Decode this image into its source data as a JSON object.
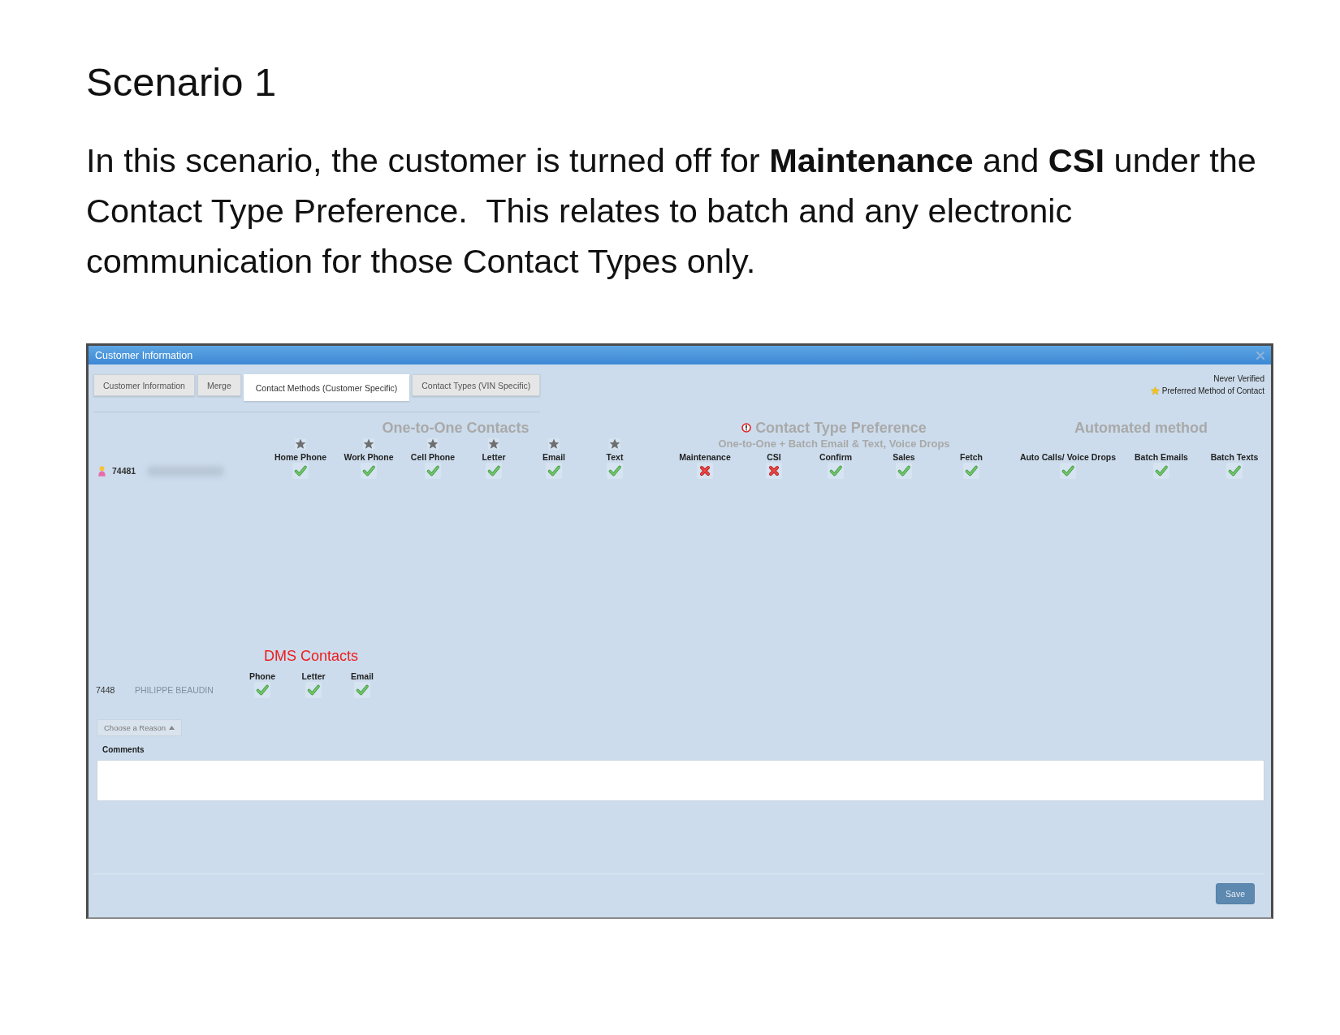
{
  "document": {
    "title": "Scenario 1",
    "paragraph": "In this scenario, the customer is turned off for **Maintenance** and **CSI** under the Contact Type Preference.  This relates to batch and any electronic communication for those Contact Types only."
  },
  "window": {
    "title": "Customer Information"
  },
  "tabs": [
    {
      "label": "Customer Information",
      "selected": false
    },
    {
      "label": "Merge",
      "selected": false
    },
    {
      "label": "Contact Methods (Customer Specific)",
      "selected": true
    },
    {
      "label": "Contact Types (VIN Specific)",
      "selected": false
    }
  ],
  "legend": {
    "status": "Never Verified",
    "preferred_label": "Preferred Method of Contact"
  },
  "customer": {
    "id": "74481",
    "name_hidden": true
  },
  "groups": [
    {
      "kind": "one_to_one",
      "title": "One-to-One Contacts",
      "columns": [
        {
          "label": "Home Phone",
          "preferred": false,
          "enabled": true
        },
        {
          "label": "Work Phone",
          "preferred": false,
          "enabled": true
        },
        {
          "label": "Cell Phone",
          "preferred": false,
          "enabled": true
        },
        {
          "label": "Letter",
          "preferred": false,
          "enabled": true
        },
        {
          "label": "Email",
          "preferred": false,
          "enabled": true
        },
        {
          "label": "Text",
          "preferred": false,
          "enabled": true
        }
      ]
    },
    {
      "kind": "contact_type",
      "title": "Contact Type Preference",
      "warning": true,
      "subtitle": "One-to-One + Batch Email & Text, Voice Drops",
      "columns": [
        {
          "label": "Maintenance",
          "enabled": false
        },
        {
          "label": "CSI",
          "enabled": false
        },
        {
          "label": "Confirm",
          "enabled": true
        },
        {
          "label": "Sales",
          "enabled": true
        },
        {
          "label": "Fetch",
          "enabled": true
        }
      ]
    },
    {
      "kind": "automated",
      "title": "Automated method",
      "columns": [
        {
          "label": "Auto Calls/ Voice Drops",
          "enabled": true
        },
        {
          "label": "Batch Emails",
          "enabled": true
        },
        {
          "label": "Batch Texts",
          "enabled": true
        }
      ]
    }
  ],
  "dms": {
    "title": "DMS Contacts",
    "id": "7448",
    "name": "PHILIPPE BEAUDIN",
    "columns": [
      {
        "label": "Phone",
        "enabled": true
      },
      {
        "label": "Letter",
        "enabled": true
      },
      {
        "label": "Email",
        "enabled": true
      }
    ]
  },
  "reason_button": {
    "label": "Choose a Reason"
  },
  "comments": {
    "label": "Comments"
  },
  "save_button": {
    "label": "Save"
  }
}
